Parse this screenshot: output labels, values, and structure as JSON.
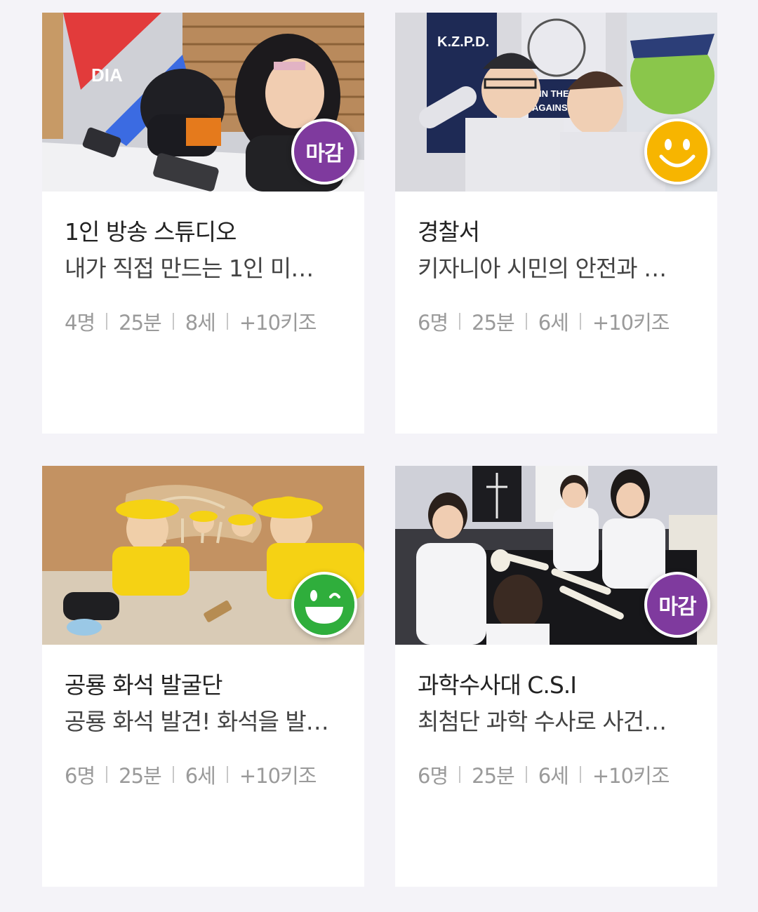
{
  "cards": [
    {
      "title": "1인 방송 스튜디오",
      "description": "내가 직접 만드는 1인 미…",
      "people": "4명",
      "duration": "25분",
      "age": "8세",
      "reward": "+10키조",
      "badge": {
        "type": "closed",
        "label": "마감",
        "color": "#7f3a9e"
      },
      "photo": {
        "scene": "broadcast-studio",
        "colors": [
          "#d8d8dc",
          "#b8895a",
          "#e23b3b"
        ]
      }
    },
    {
      "title": "경찰서",
      "description": "키자니아 시민의 안전과 …",
      "people": "6명",
      "duration": "25분",
      "age": "6세",
      "reward": "+10키조",
      "badge": {
        "type": "smiley-yellow",
        "icon": "smiley-face-icon",
        "color": "#f7b500"
      },
      "photo": {
        "scene": "police-station",
        "colors": [
          "#1e2a55",
          "#e8e8ec",
          "#3a3a40"
        ]
      }
    },
    {
      "title": "공룡 화석 발굴단",
      "description": "공룡 화석 발견! 화석을 발…",
      "people": "6명",
      "duration": "25분",
      "age": "6세",
      "reward": "+10키조",
      "badge": {
        "type": "smiley-green",
        "icon": "grin-face-icon",
        "color": "#2fae3c"
      },
      "photo": {
        "scene": "dinosaur-dig",
        "colors": [
          "#c89a6a",
          "#f5d214",
          "#e2d6c6"
        ]
      }
    },
    {
      "title": "과학수사대 C.S.I",
      "description": "최첨단 과학 수사로 사건…",
      "people": "6명",
      "duration": "25분",
      "age": "6세",
      "reward": "+10키조",
      "badge": {
        "type": "closed",
        "label": "마감",
        "color": "#7f3a9e"
      },
      "photo": {
        "scene": "csi-lab",
        "colors": [
          "#2a2a2e",
          "#f2f2f2",
          "#e8e4da"
        ]
      }
    }
  ]
}
